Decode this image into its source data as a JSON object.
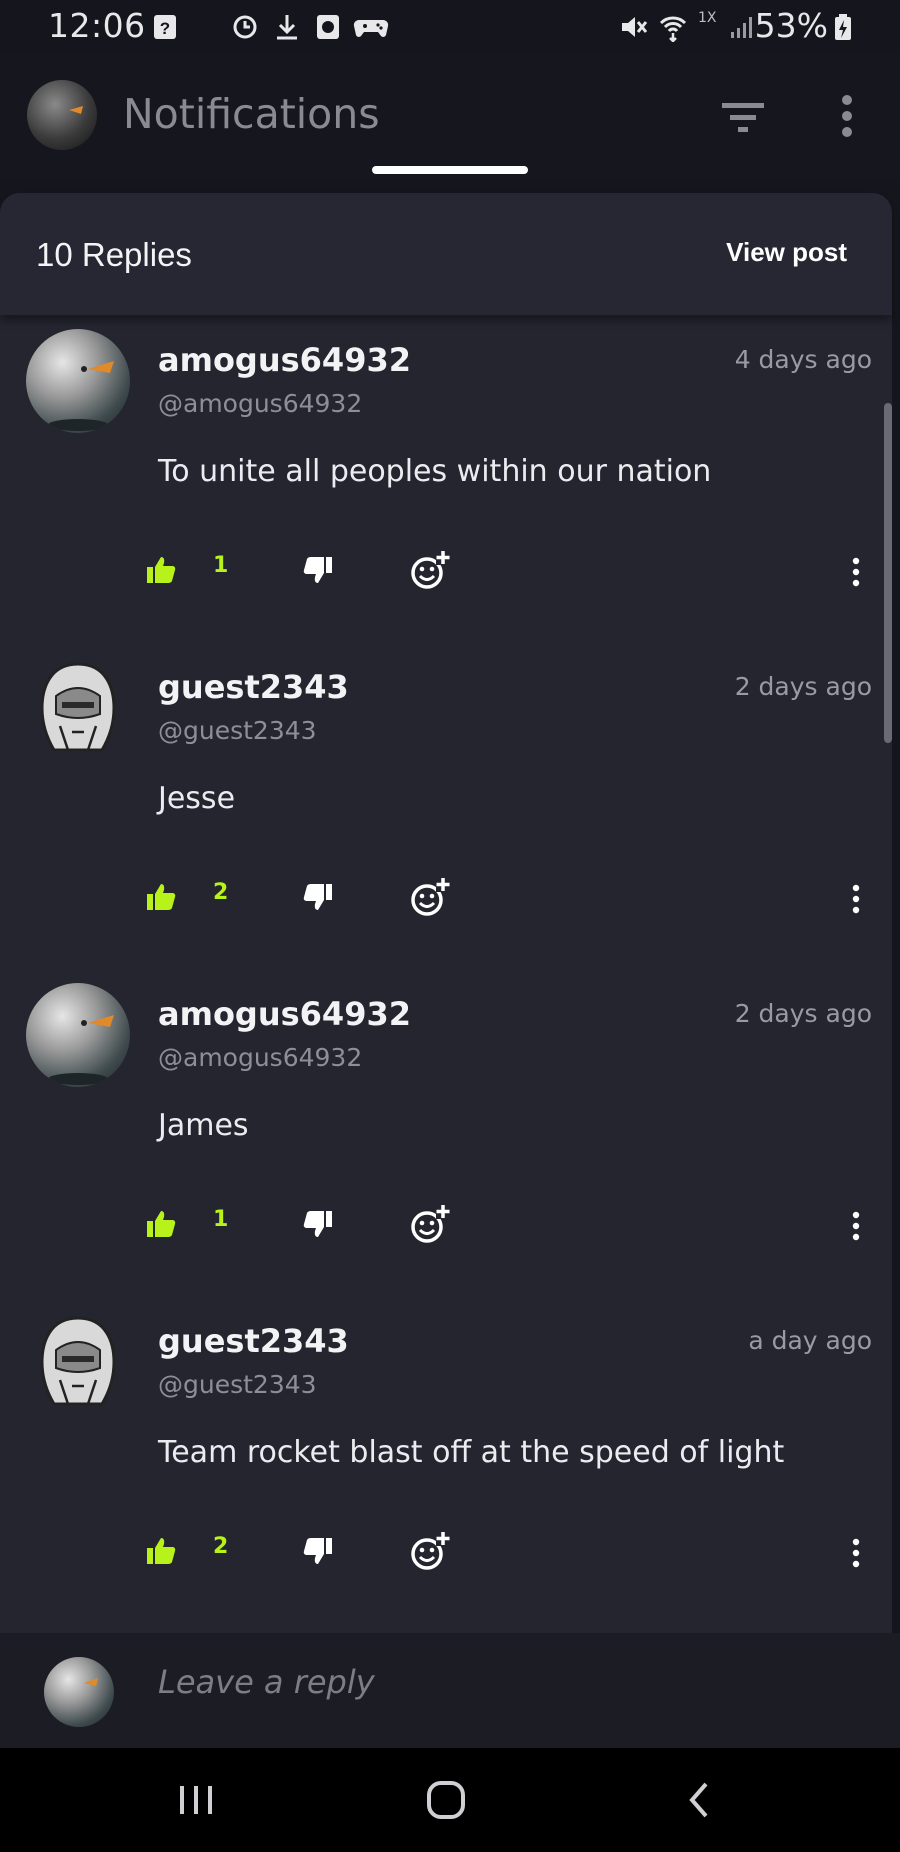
{
  "status": {
    "time": "12:06",
    "network": "1X",
    "battery": "53%"
  },
  "header": {
    "title": "Notifications"
  },
  "sheet": {
    "title": "10 Replies",
    "view_post": "View post"
  },
  "comments": [
    {
      "username": "amogus64932",
      "handle": "@amogus64932",
      "time": "4 days ago",
      "text": "To unite all peoples within our nation",
      "likes": "1",
      "avatar": "ball"
    },
    {
      "username": "guest2343",
      "handle": "@guest2343",
      "time": "2 days ago",
      "text": "Jesse",
      "likes": "2",
      "avatar": "ghost"
    },
    {
      "username": "amogus64932",
      "handle": "@amogus64932",
      "time": "2 days ago",
      "text": "James",
      "likes": "1",
      "avatar": "ball"
    },
    {
      "username": "guest2343",
      "handle": "@guest2343",
      "time": "a day ago",
      "text": "Team rocket blast off at the speed of light",
      "likes": "2",
      "avatar": "ghost"
    }
  ],
  "reply": {
    "placeholder": "Leave a reply"
  },
  "colors": {
    "background": "#15161d",
    "sheet": "#252530",
    "like_accent": "#b7f21b"
  }
}
